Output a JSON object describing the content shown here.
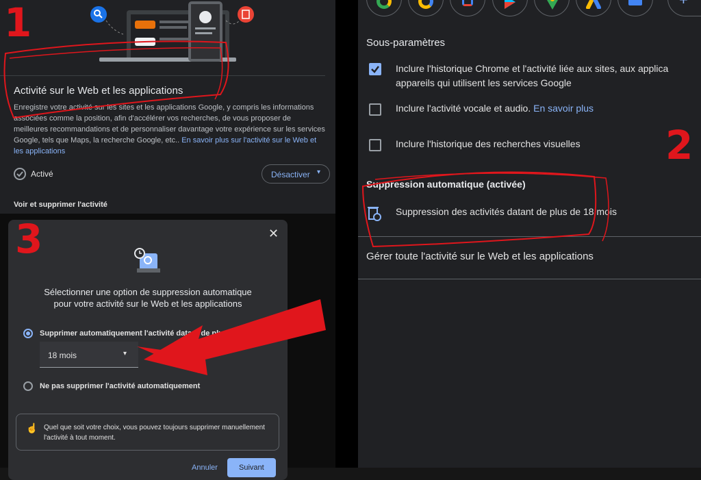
{
  "left_panel": {
    "title": "Activité sur le Web et les applications",
    "description": "Enregistre votre activité sur les sites et les applications Google, y compris les informations associées comme la position, afin d'accélérer vos recherches, de vous proposer de meilleures recommandations et de personnaliser davantage votre expérience sur les services Google, tels que Maps, la recherche Google, etc..",
    "learn_more_link": "En savoir plus sur l'activité sur le Web et les applications",
    "status_label": "Activé",
    "deactivate_button": "Désactiver",
    "section_title": "Voir et supprimer l'activité"
  },
  "right_panel": {
    "subsettings_title": "Sous-paramètres",
    "options": [
      {
        "label": "Inclure l'historique Chrome et l'activité liée aux sites, aux applica",
        "label_line2": "appareils qui utilisent les services Google",
        "checked": true
      },
      {
        "label": "Inclure l'activité vocale et audio.",
        "link": "En savoir plus",
        "checked": false
      },
      {
        "label": "Inclure l'historique des recherches visuelles",
        "checked": false
      }
    ],
    "autodelete_title": "Suppression automatique (activée)",
    "autodelete_text": "Suppression des activités datant de plus de 18 mois",
    "manage_link": "Gérer toute l'activité sur le Web et les applications",
    "app_icons": [
      "chrome-icon",
      "chrome-alt-icon",
      "lens-icon",
      "play-store-icon",
      "maps-icon",
      "ads-icon",
      "news-icon",
      "add-icon"
    ]
  },
  "dialog": {
    "title_line1": "Sélectionner une option de suppression automatique",
    "title_line2": "pour votre activité sur le Web et les applications",
    "option1": "Supprimer automatiquement l'activité datant de plus",
    "dropdown_value": "18 mois",
    "option2": "Ne pas supprimer l'activité automatiquement",
    "info_line1": "Quel que soit votre choix, vous pouvez toujours supprimer manuellement",
    "info_line2": "l'activité à tout moment.",
    "cancel_button": "Annuler",
    "next_button": "Suivant"
  },
  "annotations": {
    "step1": "1",
    "step2": "2",
    "step3": "3"
  },
  "colors": {
    "accent": "#8ab4f8",
    "annotation_red": "#e0161c",
    "panel_bg": "#202124",
    "dialog_bg": "#2d2e31"
  }
}
